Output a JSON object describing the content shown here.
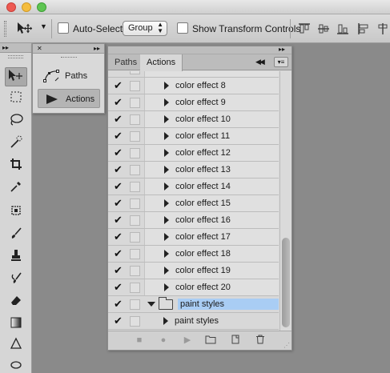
{
  "options_bar": {
    "auto_select_label": "Auto-Select:",
    "auto_select_value": "Group",
    "show_transform_label": "Show Transform Controls"
  },
  "icon_panel": {
    "paths_label": "Paths",
    "actions_label": "Actions"
  },
  "panel": {
    "tabs": [
      {
        "label": "Paths"
      },
      {
        "label": "Actions"
      }
    ]
  },
  "actions": [
    {
      "label": "color effect 8"
    },
    {
      "label": "color effect 9"
    },
    {
      "label": "color effect 10"
    },
    {
      "label": "color effect 11"
    },
    {
      "label": "color effect 12"
    },
    {
      "label": "color effect 13"
    },
    {
      "label": "color effect 14"
    },
    {
      "label": "color effect 15"
    },
    {
      "label": "color effect 16"
    },
    {
      "label": "color effect 17"
    },
    {
      "label": "color effect 18"
    },
    {
      "label": "color effect 19"
    },
    {
      "label": "color effect 20"
    }
  ],
  "action_set": {
    "label": "paint styles"
  },
  "action_set_child": {
    "label": "paint styles"
  },
  "colors": {
    "selection": "#a9cdf4",
    "panel_bg": "#d8d8d8"
  }
}
